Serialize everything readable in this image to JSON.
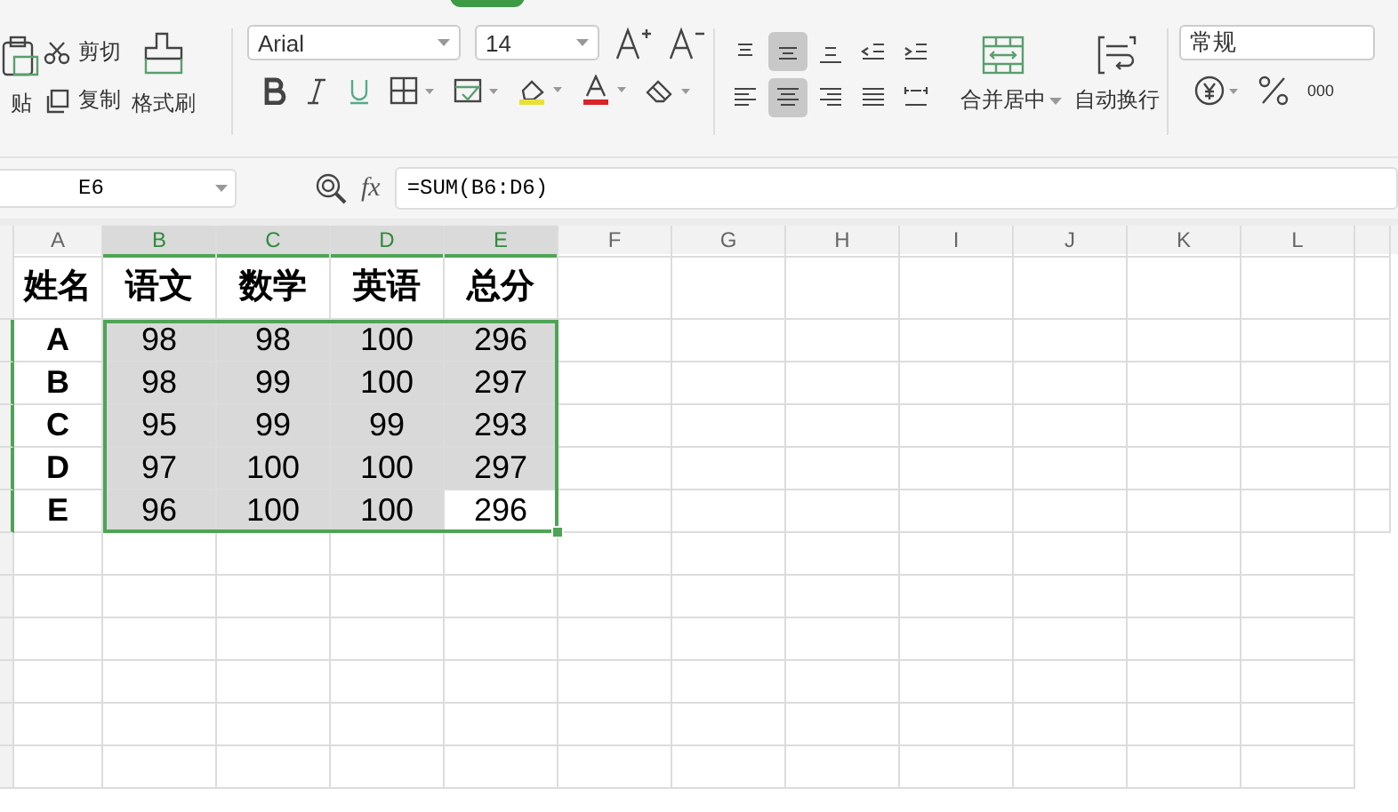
{
  "toolbar": {
    "clipboard": {
      "paste": "贴",
      "cut": "剪切",
      "copy": "复制",
      "format_painter": "格式刷"
    },
    "font": {
      "name": "Arial",
      "size": "14"
    },
    "align_rows": [
      [
        {
          "kind": "top",
          "selected": false
        },
        {
          "kind": "middle",
          "selected": true
        },
        {
          "kind": "bottom",
          "selected": false
        },
        {
          "kind": "outdent",
          "selected": false
        },
        {
          "kind": "indent",
          "selected": false
        }
      ],
      [
        {
          "kind": "left",
          "selected": false
        },
        {
          "kind": "center",
          "selected": true
        },
        {
          "kind": "right",
          "selected": false
        },
        {
          "kind": "justify",
          "selected": false
        },
        {
          "kind": "distribute",
          "selected": false
        }
      ]
    ],
    "merge": "合并居中",
    "wrap": "自动换行",
    "number_format": "常规",
    "thousands": "000"
  },
  "formula_bar": {
    "name_box": "E6",
    "fx": "fx",
    "formula": "=SUM(B6:D6)"
  },
  "sheet": {
    "columns": [
      {
        "label": "A",
        "selected": false
      },
      {
        "label": "B",
        "selected": true
      },
      {
        "label": "C",
        "selected": true
      },
      {
        "label": "D",
        "selected": true
      },
      {
        "label": "E",
        "selected": true
      },
      {
        "label": "F",
        "selected": false
      },
      {
        "label": "G",
        "selected": false
      },
      {
        "label": "H",
        "selected": false
      },
      {
        "label": "I",
        "selected": false
      },
      {
        "label": "J",
        "selected": false
      },
      {
        "label": "K",
        "selected": false
      },
      {
        "label": "L",
        "selected": false
      }
    ],
    "header_row": [
      "姓名",
      "语文",
      "数学",
      "英语",
      "总分"
    ],
    "rows": [
      {
        "selected": true,
        "cells": [
          {
            "text": "A",
            "selected": false
          },
          {
            "text": "98",
            "selected": true
          },
          {
            "text": "98",
            "selected": true
          },
          {
            "text": "100",
            "selected": true
          },
          {
            "text": "296",
            "selected": true
          }
        ]
      },
      {
        "selected": true,
        "cells": [
          {
            "text": "B",
            "selected": false
          },
          {
            "text": "98",
            "selected": true
          },
          {
            "text": "99",
            "selected": true
          },
          {
            "text": "100",
            "selected": true
          },
          {
            "text": "297",
            "selected": true
          }
        ]
      },
      {
        "selected": true,
        "cells": [
          {
            "text": "C",
            "selected": false
          },
          {
            "text": "95",
            "selected": true
          },
          {
            "text": "99",
            "selected": true
          },
          {
            "text": "99",
            "selected": true
          },
          {
            "text": "293",
            "selected": true
          }
        ]
      },
      {
        "selected": true,
        "cells": [
          {
            "text": "D",
            "selected": false
          },
          {
            "text": "97",
            "selected": true
          },
          {
            "text": "100",
            "selected": true
          },
          {
            "text": "100",
            "selected": true
          },
          {
            "text": "297",
            "selected": true
          }
        ]
      },
      {
        "selected": true,
        "cells": [
          {
            "text": "E",
            "selected": false
          },
          {
            "text": "96",
            "selected": true
          },
          {
            "text": "100",
            "selected": true
          },
          {
            "text": "100",
            "selected": true
          },
          {
            "text": "296",
            "selected": false
          }
        ]
      }
    ]
  }
}
